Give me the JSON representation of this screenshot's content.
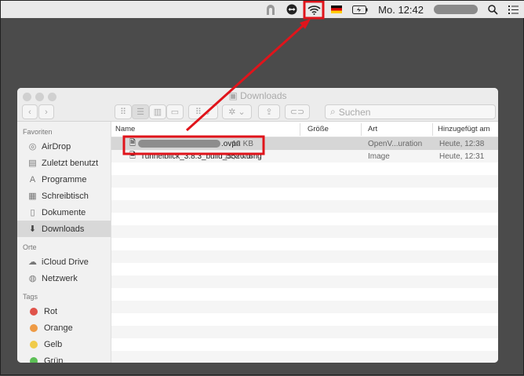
{
  "menubar": {
    "clock": "Mo. 12:42",
    "icons": [
      "tunnelblick-icon",
      "teamviewer-icon",
      "wifi-icon",
      "german-flag-icon",
      "battery-icon",
      "search-icon",
      "list-icon"
    ]
  },
  "window": {
    "title": "Downloads",
    "search_placeholder": "Suchen"
  },
  "sidebar": {
    "favorites_header": "Favoriten",
    "favorites": [
      {
        "label": "AirDrop",
        "icon": "airdrop-icon"
      },
      {
        "label": "Zuletzt benutzt",
        "icon": "recents-icon"
      },
      {
        "label": "Programme",
        "icon": "applications-icon"
      },
      {
        "label": "Schreibtisch",
        "icon": "desktop-icon"
      },
      {
        "label": "Dokumente",
        "icon": "documents-icon"
      },
      {
        "label": "Downloads",
        "icon": "downloads-icon",
        "selected": true
      }
    ],
    "places_header": "Orte",
    "places": [
      {
        "label": "iCloud Drive",
        "icon": "cloud-icon"
      },
      {
        "label": "Netzwerk",
        "icon": "network-icon"
      }
    ],
    "tags_header": "Tags",
    "tags": [
      {
        "label": "Rot",
        "color": "#e0534a"
      },
      {
        "label": "Orange",
        "color": "#ee9a45"
      },
      {
        "label": "Gelb",
        "color": "#f0cb4a"
      },
      {
        "label": "Grün",
        "color": "#5cbf55"
      }
    ]
  },
  "columns": {
    "name": "Name",
    "size": "Größe",
    "kind": "Art",
    "added": "Hinzugefügt am"
  },
  "files": [
    {
      "name": ".ovpn",
      "size": "12 KB",
      "kind": "OpenV...uration",
      "added": "Heute, 12:38",
      "selected": true
    },
    {
      "name": "Tunnelblick_3.8.3_build_5520.dmg",
      "size": "14,8 MB",
      "kind": "Image",
      "added": "Heute, 12:31"
    }
  ],
  "annotation_color": "#e0141b"
}
